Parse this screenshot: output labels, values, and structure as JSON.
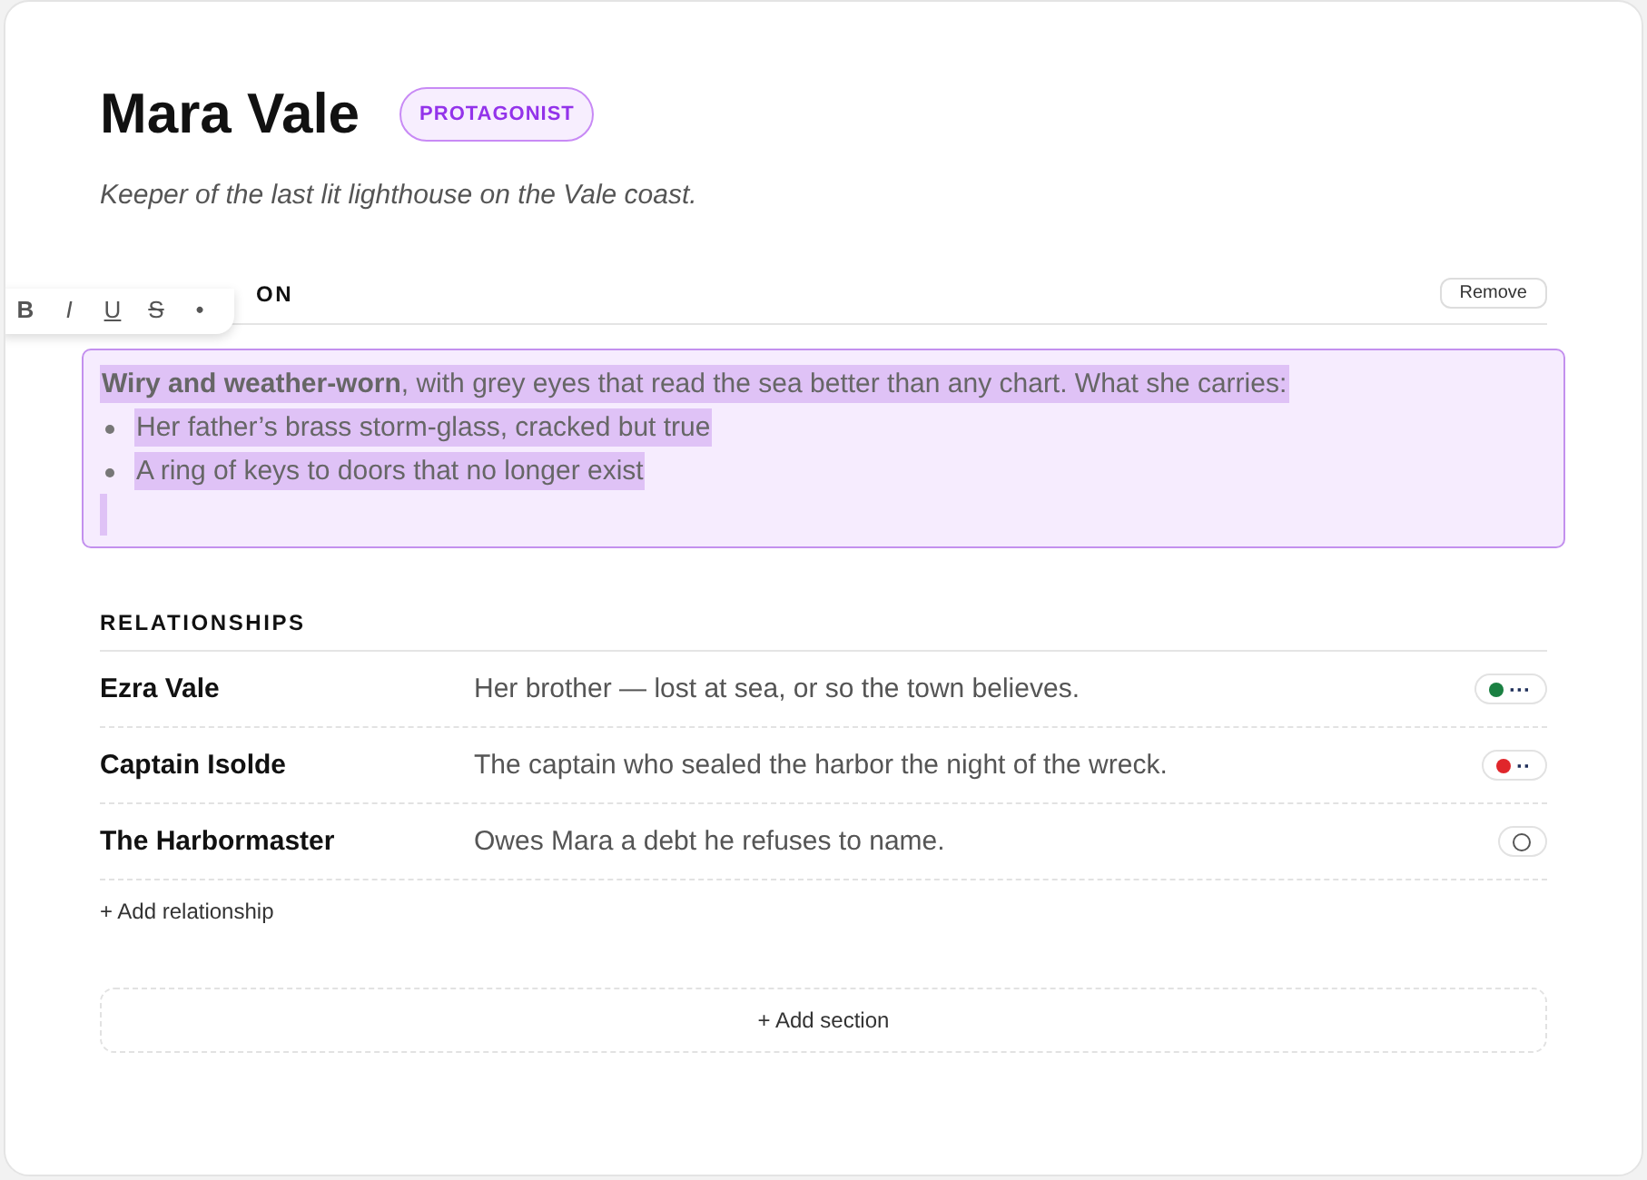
{
  "character": {
    "name": "Mara Vale",
    "role_badge": "PROTAGONIST",
    "tagline": "Keeper of the last lit lighthouse on the Vale coast."
  },
  "toolbar": [
    {
      "label": "B",
      "kind": "bold"
    },
    {
      "label": "I",
      "kind": "italic"
    },
    {
      "label": "U",
      "kind": "underline"
    },
    {
      "label": "S",
      "kind": "strike"
    },
    {
      "label": "•",
      "kind": "bullet"
    }
  ],
  "description": {
    "heading_visible": "ON",
    "remove_button": "Remove",
    "editing": true,
    "paragraph": "**Wiry and weather-worn**, with grey eyes that read the sea better than any chart. What she carries:",
    "bullets": [
      "Her father’s brass storm-glass, cracked but true",
      "A ring of keys to doors that no longer exist"
    ]
  },
  "relationships": {
    "heading": "RELATIONSHIPS",
    "rows": [
      {
        "name": "Ezra Vale",
        "note": "Her brother — lost at sea, or so the town believes.",
        "kind": "dot",
        "color": "#1a8042",
        "dots": "···"
      },
      {
        "name": "Captain Isolde",
        "note": "The captain who sealed the harbor the night of the wreck.",
        "kind": "dot",
        "color": "#e0262b",
        "dots": "··"
      },
      {
        "name": "The Harbormaster",
        "note": "Owes Mara a debt he refuses to name.",
        "kind": "empty"
      }
    ],
    "add_link": "+ Add relationship"
  },
  "add_section": "+ Add section"
}
